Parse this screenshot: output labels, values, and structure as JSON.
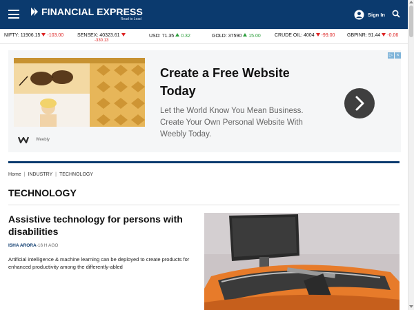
{
  "header": {
    "logo_text": "FINANCIAL EXPRESS",
    "tagline": "Read to Lead",
    "signin_label": "Sign In",
    "background_color": "#0b3a6e"
  },
  "ticker": [
    {
      "name": "NIFTY:",
      "value": "11906.15",
      "direction": "down",
      "change": "-103.00"
    },
    {
      "name": "SENSEX:",
      "value": "40323.61",
      "direction": "down",
      "change": "-330.13"
    },
    {
      "name": "USD:",
      "value": "71.35",
      "direction": "up",
      "change": "0.32"
    },
    {
      "name": "GOLD:",
      "value": "37590",
      "direction": "up",
      "change": "15.00"
    },
    {
      "name": "CRUDE OIL:",
      "value": "4004",
      "direction": "down",
      "change": "-99.00"
    },
    {
      "name": "GBPINR:",
      "value": "91.44",
      "direction": "down",
      "change": "-0.06"
    }
  ],
  "ad": {
    "headline": "Create a Free Website Today",
    "body": "Let the World Know You Mean Business. Create Your Own Personal Website With Weebly Today.",
    "brand": "Weebly",
    "logo_letter": "W"
  },
  "breadcrumb": [
    "Home",
    "INDUSTRY",
    "TECHNOLOGY"
  ],
  "section_title": "TECHNOLOGY",
  "article": {
    "title": "Assistive technology for persons with disabilities",
    "author": "ISHA ARORA",
    "time": "-16 H AGO",
    "summary": "Artificial intelligence & machine learning can be deployed to create products for enhanced productivity among the differently-abled"
  }
}
